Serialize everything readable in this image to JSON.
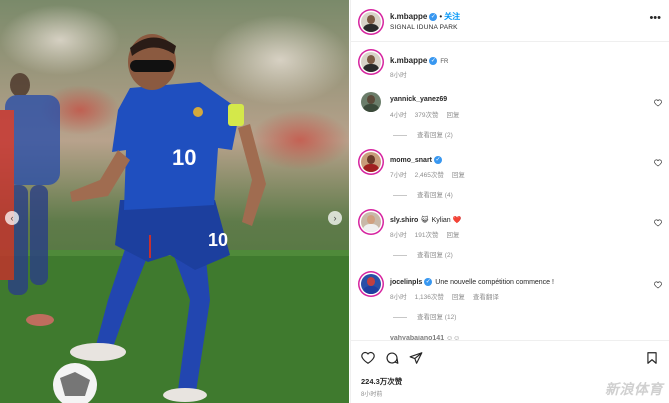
{
  "post": {
    "username": "k.mbappe",
    "follow_label": "关注",
    "location": "SIGNAL IDUNA PARK",
    "caption_flag": "FR",
    "caption_time": "8小时",
    "likes": "224.3万次赞",
    "time": "8小时前"
  },
  "comments": [
    {
      "username": "yannick_yanez69",
      "verified": false,
      "emoji": "",
      "text": "",
      "time": "4小时",
      "likes": "379次赞",
      "reply": "回复",
      "translate": "",
      "replies": "查看回复 (2)"
    },
    {
      "username": "momo_snart",
      "verified": true,
      "emoji": "",
      "text": "",
      "time": "7小时",
      "likes": "2,465次赞",
      "reply": "回复",
      "translate": "",
      "replies": "查看回复 (4)"
    },
    {
      "username": "sly.shiro",
      "verified": false,
      "emoji": "😺",
      "text": "Kylian ❤️",
      "time": "8小时",
      "likes": "191次赞",
      "reply": "回复",
      "translate": "",
      "replies": "查看回复 (2)"
    },
    {
      "username": "jocelinpls",
      "verified": true,
      "emoji": "",
      "text": "Une nouvelle compétition commence !",
      "time": "8小时",
      "likes": "1,136次赞",
      "reply": "回复",
      "translate": "查看翻译",
      "replies": "查看回复 (12)"
    }
  ],
  "partial_comment": "vahyabaiano141 ☺☺",
  "photo": {
    "jersey_number": "10"
  },
  "watermark": "新浪体育",
  "colors": {
    "accent": "#0095f6",
    "verified": "#3897f0",
    "story_ring": "#d6249f",
    "jersey": "#1f4fbf"
  },
  "icons": [
    "more-icon",
    "heart-icon",
    "comment-icon",
    "share-icon",
    "bookmark-icon",
    "verified-icon",
    "prev-arrow-icon",
    "next-arrow-icon"
  ]
}
